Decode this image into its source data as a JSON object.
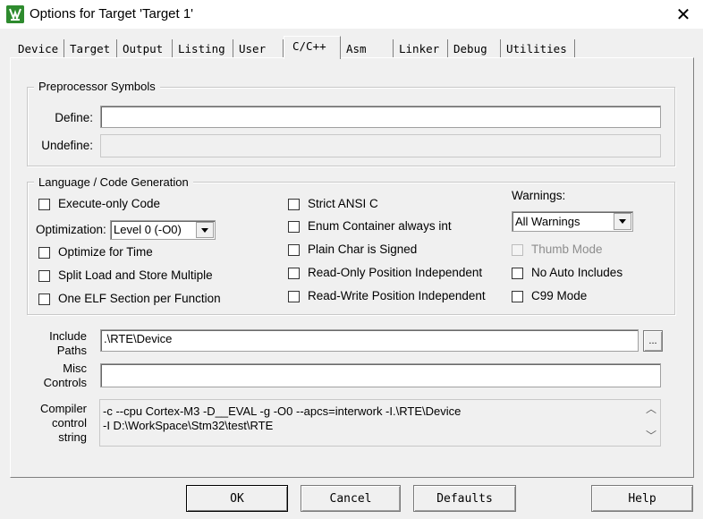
{
  "window": {
    "title": "Options for Target 'Target 1'",
    "close_glyph": "✕"
  },
  "tabs": [
    {
      "label": "Device"
    },
    {
      "label": "Target"
    },
    {
      "label": "Output"
    },
    {
      "label": "Listing"
    },
    {
      "label": "User"
    },
    {
      "label": "C/C++"
    },
    {
      "label": "Asm"
    },
    {
      "label": "Linker"
    },
    {
      "label": "Debug"
    },
    {
      "label": "Utilities"
    }
  ],
  "active_tab": "C/C++",
  "preprocessor": {
    "legend": "Preprocessor Symbols",
    "define_label": "Define:",
    "define_value": "",
    "undefine_label": "Undefine:",
    "undefine_value": ""
  },
  "language": {
    "legend": "Language / Code Generation",
    "execute_only": "Execute-only Code",
    "optimization_label": "Optimization:",
    "optimization_value": "Level 0 (-O0)",
    "optimize_time": "Optimize for Time",
    "split_load": "Split Load and Store Multiple",
    "one_elf": "One ELF Section per Function",
    "strict_ansi": "Strict ANSI C",
    "enum_container": "Enum Container always int",
    "plain_char": "Plain Char is Signed",
    "ro_position": "Read-Only Position Independent",
    "rw_position": "Read-Write Position Independent",
    "warnings_label": "Warnings:",
    "warnings_value": "All Warnings",
    "thumb_mode": "Thumb Mode",
    "no_auto_includes": "No Auto Includes",
    "c99_mode": "C99 Mode"
  },
  "include": {
    "label_line1": "Include",
    "label_line2": "Paths",
    "value": ".\\RTE\\Device",
    "browse_label": "..."
  },
  "misc": {
    "label_line1": "Misc",
    "label_line2": "Controls",
    "value": ""
  },
  "compiler": {
    "label_line1": "Compiler",
    "label_line2": "control",
    "label_line3": "string",
    "line1": "-c --cpu Cortex-M3 -D__EVAL -g -O0 --apcs=interwork -I.\\RTE\\Device",
    "line2": "-I D:\\WorkSpace\\Stm32\\test\\RTE",
    "scroll_up_glyph": "︿",
    "scroll_down_glyph": "﹀"
  },
  "buttons": {
    "ok": "OK",
    "cancel": "Cancel",
    "defaults": "Defaults",
    "help": "Help"
  },
  "colors": {
    "icon_green": "#2e8b2e",
    "dialog_bg": "#f0f0f0"
  }
}
